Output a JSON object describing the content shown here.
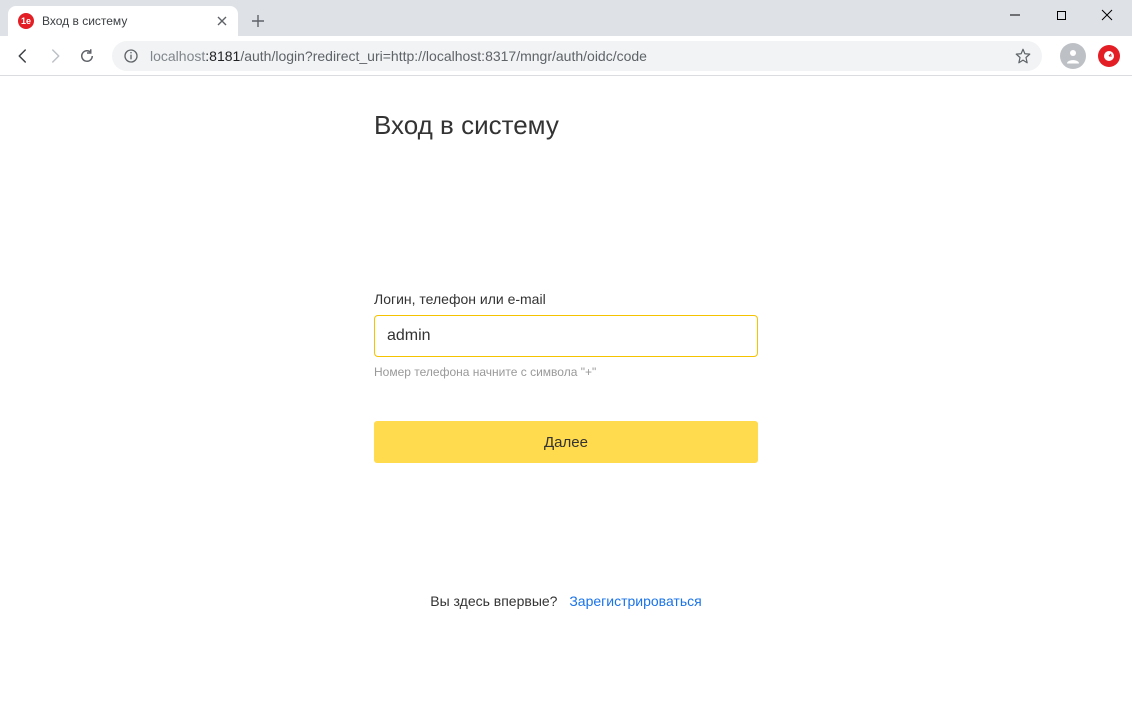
{
  "chrome": {
    "tab_title": "Вход в систему",
    "favicon_text": "1e",
    "url_host_fade": "localhost",
    "url_host_port": ":8181",
    "url_path": "/auth/login?redirect_uri=http://localhost:8317/mngr/auth/oidc/code"
  },
  "login": {
    "title": "Вход в систему",
    "field_label": "Логин, телефон или e-mail",
    "input_value": "admin",
    "hint": "Номер телефона начните с символа \"+\"",
    "submit_label": "Далее",
    "first_time_text": "Вы здесь впервые?",
    "register_link": "Зарегистрироваться"
  }
}
